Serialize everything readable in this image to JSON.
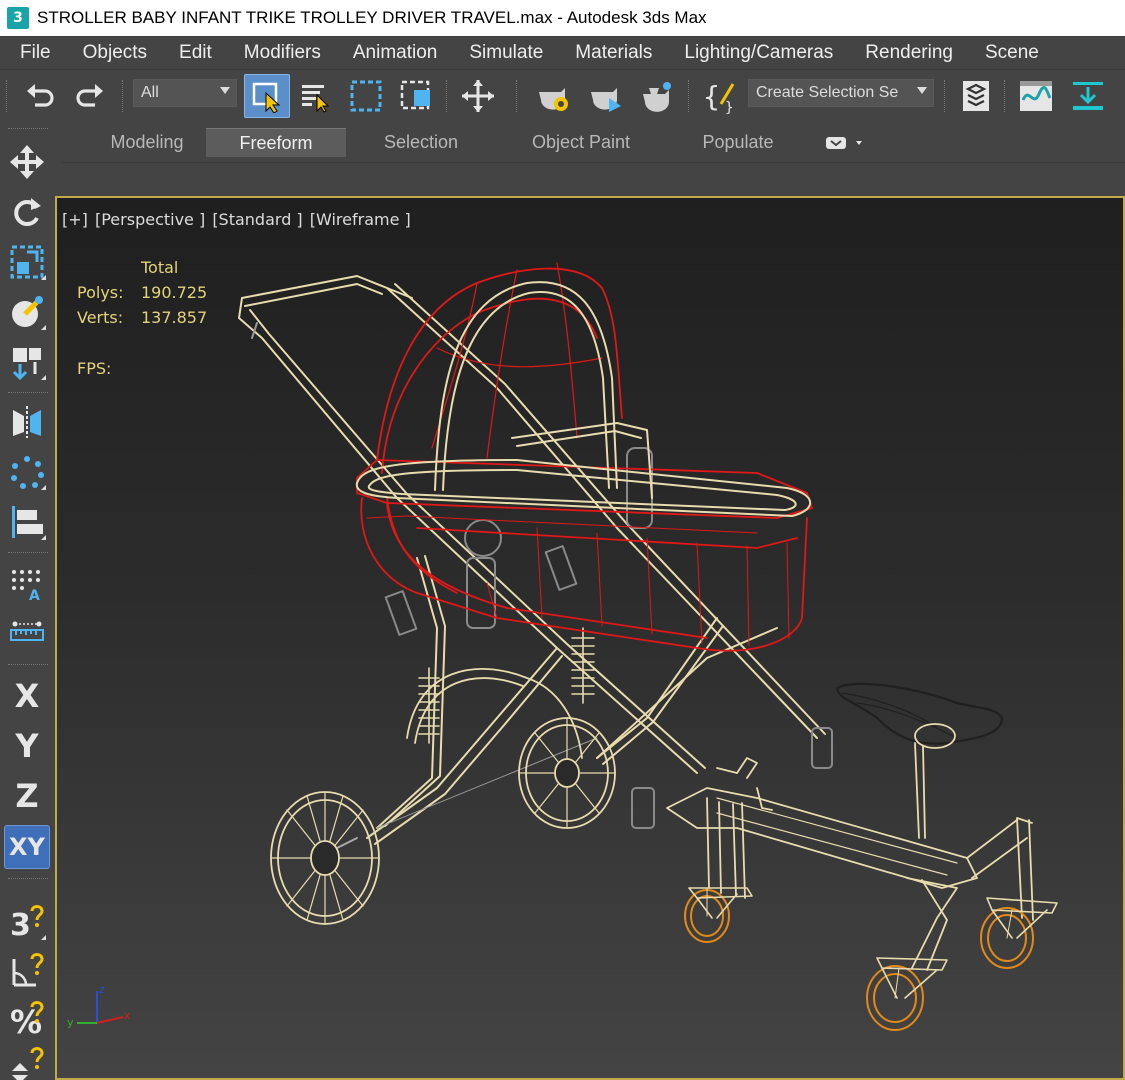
{
  "window": {
    "title": "STROLLER  BABY INFANT TRIKE TROLLEY DRIVER TRAVEL.max - Autodesk 3ds Max",
    "app_icon_label": "3"
  },
  "menu": [
    "File",
    "Objects",
    "Edit",
    "Modifiers",
    "Animation",
    "Simulate",
    "Materials",
    "Lighting/Cameras",
    "Rendering",
    "Scene"
  ],
  "toolbar": {
    "selection_filter": "All",
    "named_selection_placeholder": "Create Selection Se",
    "icons": [
      "undo-icon",
      "redo-icon",
      "select-object-icon",
      "select-by-name-icon",
      "rectangular-selection-icon",
      "window-crossing-icon",
      "select-and-move-icon",
      "render-setup-icon",
      "rendered-frame-window-icon",
      "render-icon",
      "script-icon",
      "layer-explorer-icon",
      "curve-editor-icon",
      "toggle-ribbon-icon"
    ]
  },
  "ribbon": {
    "tabs": [
      "Modeling",
      "Freeform",
      "Selection",
      "Object Paint",
      "Populate"
    ],
    "active_tab": "Freeform"
  },
  "command_palette": {
    "axis_buttons": [
      "X",
      "Y",
      "Z",
      "XY"
    ],
    "active_axis": "XY",
    "snap_labels": [
      "3",
      "%"
    ]
  },
  "viewport": {
    "label_parts": [
      "[+]",
      "[Perspective ]",
      "[Standard ]",
      "[Wireframe ]"
    ],
    "stats": {
      "header": "Total",
      "polys_label": "Polys:",
      "polys_value": "190.725",
      "verts_label": "Verts:",
      "verts_value": "137.857",
      "fps_label": "FPS:"
    },
    "gizmo_axes": [
      "x",
      "y",
      "z"
    ],
    "colors": {
      "border": "#c2a94a",
      "stats_text": "#e3d37a",
      "frame_wire": "#e8dcae",
      "bassinet_wire": "#e01818",
      "caster_wheel": "#e08a1a",
      "seat_wire": "#202020"
    }
  }
}
